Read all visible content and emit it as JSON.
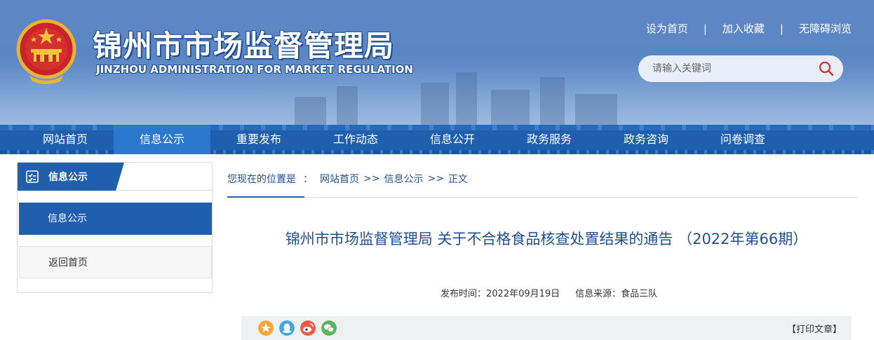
{
  "header": {
    "title_cn": "锦州市市场监督管理局",
    "title_en": "JINZHOU ADMINISTRATION FOR MARKET REGULATION",
    "links": [
      "设为首页",
      "加入收藏",
      "无障碍浏览"
    ],
    "link_separator": "|",
    "search_placeholder": "请输入关键词"
  },
  "nav": {
    "items": [
      "网站首页",
      "信息公示",
      "重要发布",
      "工作动态",
      "信息公开",
      "政务服务",
      "政务咨询",
      "问卷调查"
    ],
    "active": "信息公示"
  },
  "sidebar": {
    "heading": "信息公示",
    "items": [
      "信息公示",
      "返回首页"
    ]
  },
  "breadcrumb": {
    "prefix": "您现在的位置是",
    "colon": "：",
    "items": [
      "网站首页",
      "信息公示",
      "正文"
    ],
    "separator": ">>"
  },
  "article": {
    "title": "锦州市市场监督管理局 关于不合格食品核查处置结果的通告 （2022年第66期）",
    "publish_label": "发布时间：2022年09月19日",
    "source_label": "信息来源：食品三队"
  },
  "share": {
    "icons": [
      "qzone-icon",
      "qq-icon",
      "weibo-icon",
      "wechat-icon"
    ],
    "print_label": "【打印文章】"
  },
  "colors": {
    "primary": "#1f5fae",
    "title_text": "#1f4f93",
    "nav_active": "#2b79cf"
  }
}
